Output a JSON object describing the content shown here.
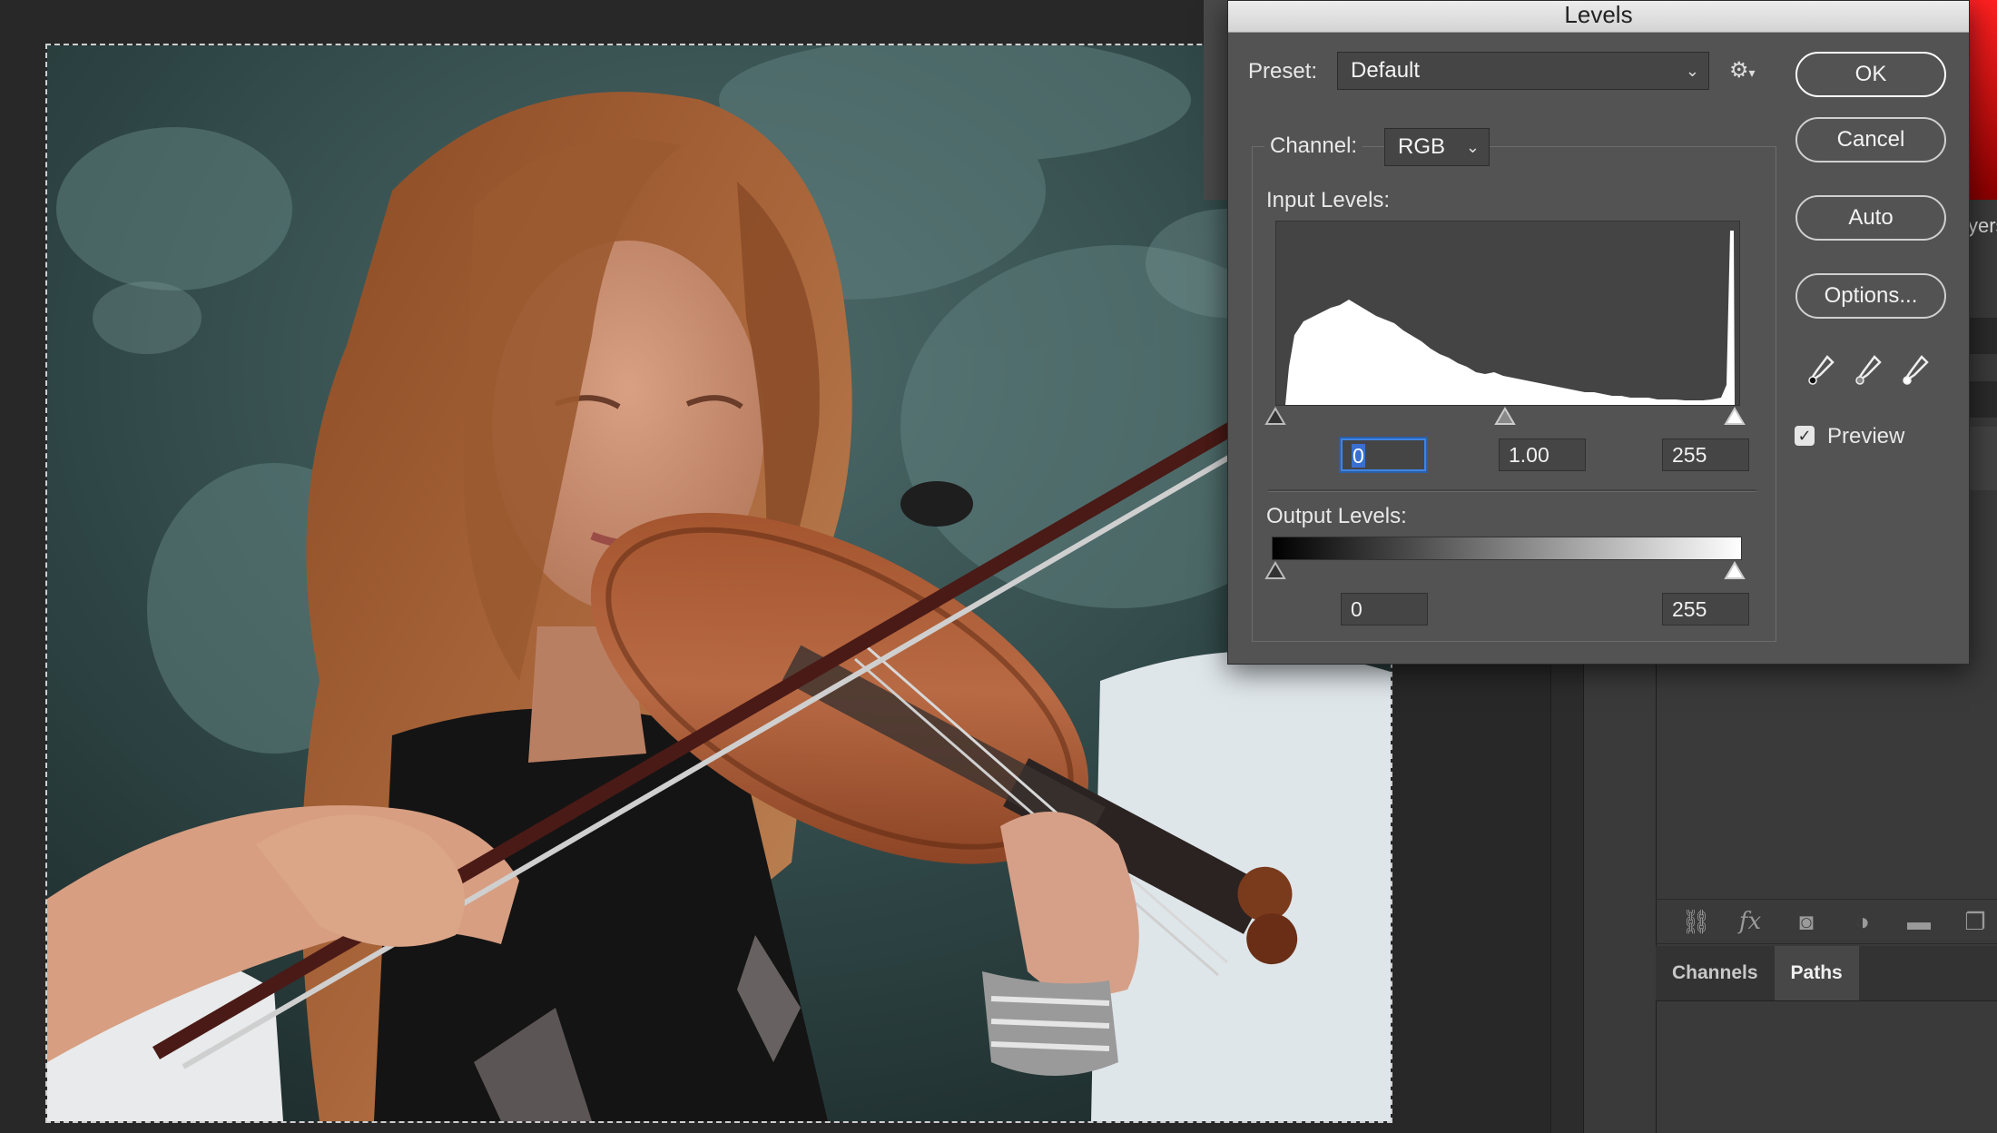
{
  "dialog": {
    "title": "Levels",
    "preset_label": "Preset:",
    "preset_value": "Default",
    "channel_label": "Channel:",
    "channel_value": "RGB",
    "input_levels_label": "Input Levels:",
    "output_levels_label": "Output Levels:",
    "input": {
      "black": "0",
      "gamma": "1.00",
      "white": "255"
    },
    "output": {
      "black": "0",
      "white": "255"
    },
    "buttons": {
      "ok": "OK",
      "cancel": "Cancel",
      "auto": "Auto",
      "options": "Options..."
    },
    "preview_label": "Preview",
    "preview_checked": true,
    "icons": [
      "gear-icon",
      "black-eyedropper-icon",
      "gray-eyedropper-icon",
      "white-eyedropper-icon"
    ]
  },
  "panels": {
    "tabs": [
      "Channels",
      "Paths"
    ],
    "active_tab": "Paths",
    "layers_header_fragment": "yers",
    "layer_icons": [
      "link-icon",
      "fx-icon",
      "mask-icon",
      "adjustment-icon",
      "folder-icon",
      "new-layer-icon"
    ],
    "fx_label": "fx"
  },
  "colors": {
    "accent": "#3d84e6",
    "dialog_bg": "#535353",
    "panel_bg": "#3a3a3a",
    "app_bg": "#282828"
  }
}
